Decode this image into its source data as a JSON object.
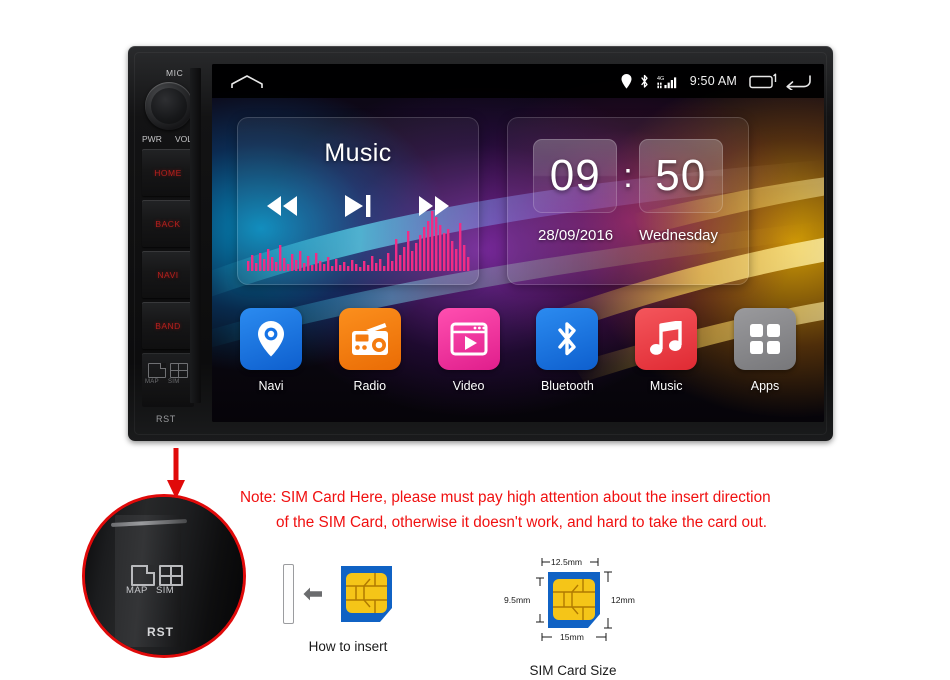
{
  "head_unit": {
    "mic_label": "MIC",
    "knob": {
      "name": "volume-power-knob",
      "left_label": "PWR",
      "right_label": "VOL"
    },
    "side_buttons": [
      {
        "label": "HOME",
        "name": "home"
      },
      {
        "label": "BACK",
        "name": "back"
      },
      {
        "label": "NAVI",
        "name": "navi"
      },
      {
        "label": "BAND",
        "name": "band"
      }
    ],
    "card_slots": {
      "map_label": "MAP",
      "sim_label": "SIM"
    },
    "reset_label": "RST",
    "accent_button_color": "#b4201d"
  },
  "screen": {
    "status_bar": {
      "home_icon": "home-icon",
      "icons": [
        "location-pin-icon",
        "bluetooth-icon",
        "signal-4g-icon"
      ],
      "network_label": "4G",
      "clock": "9:50 AM",
      "recents_icon": "recent-apps-icon",
      "back_icon": "back-arrow-icon"
    },
    "music_widget": {
      "title": "Music",
      "controls": [
        {
          "name": "previous-track-button",
          "icon": "rewind-icon"
        },
        {
          "name": "play-pause-button",
          "icon": "play-pause-icon"
        },
        {
          "name": "next-track-button",
          "icon": "fast-forward-icon"
        }
      ],
      "visualizer_color": "#ef2d86"
    },
    "clock_widget": {
      "hours": "09",
      "separator": ":",
      "minutes": "50",
      "date": "28/09/2016",
      "weekday": "Wednesday"
    },
    "apps": [
      {
        "label": "Navi",
        "icon": "map-pin-icon",
        "color": "#1573e6"
      },
      {
        "label": "Radio",
        "icon": "radio-icon",
        "color": "#f47b0f"
      },
      {
        "label": "Video",
        "icon": "video-play-icon",
        "color": "#f0369f"
      },
      {
        "label": "Bluetooth",
        "icon": "bluetooth-icon",
        "color": "#1573e6"
      },
      {
        "label": "Music",
        "icon": "music-note-icon",
        "color": "#ec3b43"
      },
      {
        "label": "Apps",
        "icon": "grid-apps-icon",
        "color": "#868689"
      }
    ]
  },
  "callout": {
    "map_label": "MAP",
    "sim_label": "SIM",
    "reset_label": "RST",
    "circle_color": "#e00a0a",
    "arrow_color": "#e00a0a"
  },
  "note": {
    "line1": "Note: SIM Card Here, please must pay high attention about the insert direction",
    "line2": "of the SIM Card, otherwise it doesn't work, and hard to take the card out.",
    "color": "#f01010"
  },
  "sim_insert": {
    "caption": "How to insert",
    "arrow_icon": "left-arrow-icon",
    "card_body_color": "#1062c4",
    "chip_color": "#f5c518"
  },
  "sim_size": {
    "caption": "SIM Card Size",
    "dim_top": "12.5mm",
    "dim_bottom": "15mm",
    "dim_left": "9.5mm",
    "dim_right": "12mm",
    "card_body_color": "#1062c4",
    "chip_color": "#f5c518"
  }
}
